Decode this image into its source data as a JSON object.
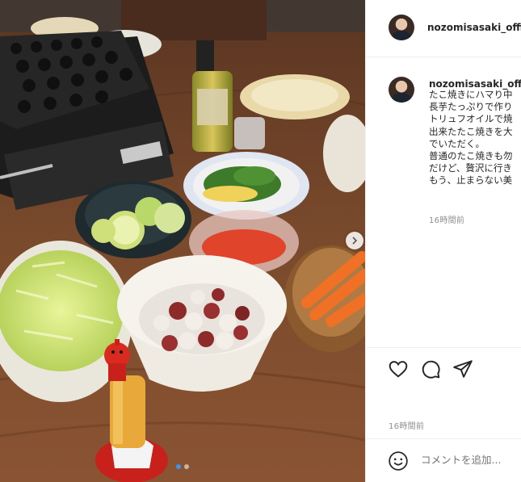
{
  "post": {
    "username": "nozomisasaki_offic",
    "caption_lines": [
      "たこ焼きにハマり中",
      "長芋たっぷりで作り",
      "トリュフオイルで焼",
      "出来たたこ焼きを大",
      "でいただく。",
      "普通のたこ焼きも勿",
      "だけど、贅沢に行き",
      "もう、止まらない美"
    ],
    "caption_time": "16時間前",
    "post_time": "16時間前",
    "comment_placeholder": "コメントを追加...",
    "carousel": {
      "slide_count": 2,
      "active_slide": 1
    }
  },
  "icons": {
    "like": "heart-icon",
    "comment": "comment-bubble-icon",
    "share": "paper-plane-icon",
    "emoji": "smiley-icon",
    "next": "chevron-right-icon"
  },
  "colors": {
    "table": "#6b3f24",
    "background_panel": "#ffffff",
    "text_primary": "#262626",
    "text_secondary": "#8e8e8e",
    "divider": "#efefef",
    "accent": "#3897f0"
  }
}
